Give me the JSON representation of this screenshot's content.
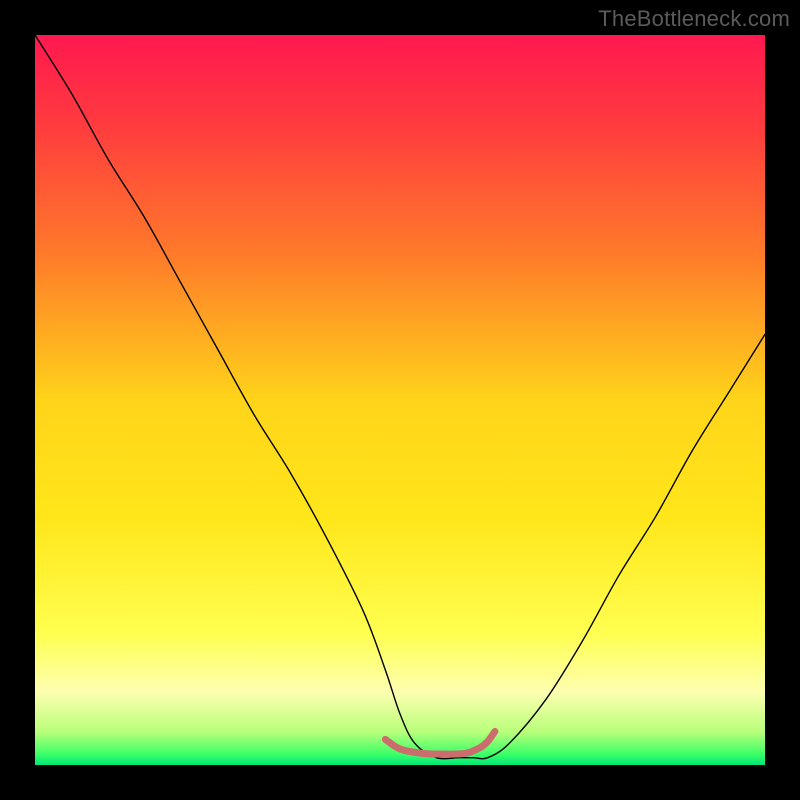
{
  "watermark": "TheBottleneck.com",
  "chart_data": {
    "type": "line",
    "title": "",
    "xlabel": "",
    "ylabel": "",
    "xlim": [
      0,
      100
    ],
    "ylim": [
      0,
      100
    ],
    "grid": false,
    "legend": false,
    "background_gradient_stops": [
      {
        "offset": 0.0,
        "color": "#ff1850"
      },
      {
        "offset": 0.12,
        "color": "#ff3a3f"
      },
      {
        "offset": 0.3,
        "color": "#ff7a2a"
      },
      {
        "offset": 0.5,
        "color": "#ffd41a"
      },
      {
        "offset": 0.66,
        "color": "#ffe61a"
      },
      {
        "offset": 0.82,
        "color": "#ffff50"
      },
      {
        "offset": 0.9,
        "color": "#fdffb0"
      },
      {
        "offset": 0.955,
        "color": "#b8ff7a"
      },
      {
        "offset": 0.985,
        "color": "#3cff68"
      },
      {
        "offset": 1.0,
        "color": "#00e676"
      }
    ],
    "series": [
      {
        "name": "bottleneck-curve",
        "stroke": "#000000",
        "stroke_width": 1.4,
        "x": [
          0,
          5,
          10,
          15,
          20,
          25,
          30,
          35,
          40,
          45,
          48,
          50,
          52,
          55,
          58,
          60,
          62,
          65,
          70,
          75,
          80,
          85,
          90,
          95,
          100
        ],
        "y": [
          100,
          92,
          83,
          75,
          66,
          57,
          48,
          40,
          31,
          21,
          13,
          7,
          3,
          1,
          1,
          1,
          1,
          3,
          9,
          17,
          26,
          34,
          43,
          51,
          59
        ]
      },
      {
        "name": "optimal-range-marker",
        "stroke": "#cc6d6d",
        "stroke_width": 7,
        "linecap": "round",
        "x": [
          48,
          50,
          53,
          56,
          59,
          61,
          62,
          63
        ],
        "y": [
          3.5,
          2.2,
          1.6,
          1.5,
          1.6,
          2.4,
          3.2,
          4.6
        ]
      }
    ]
  }
}
